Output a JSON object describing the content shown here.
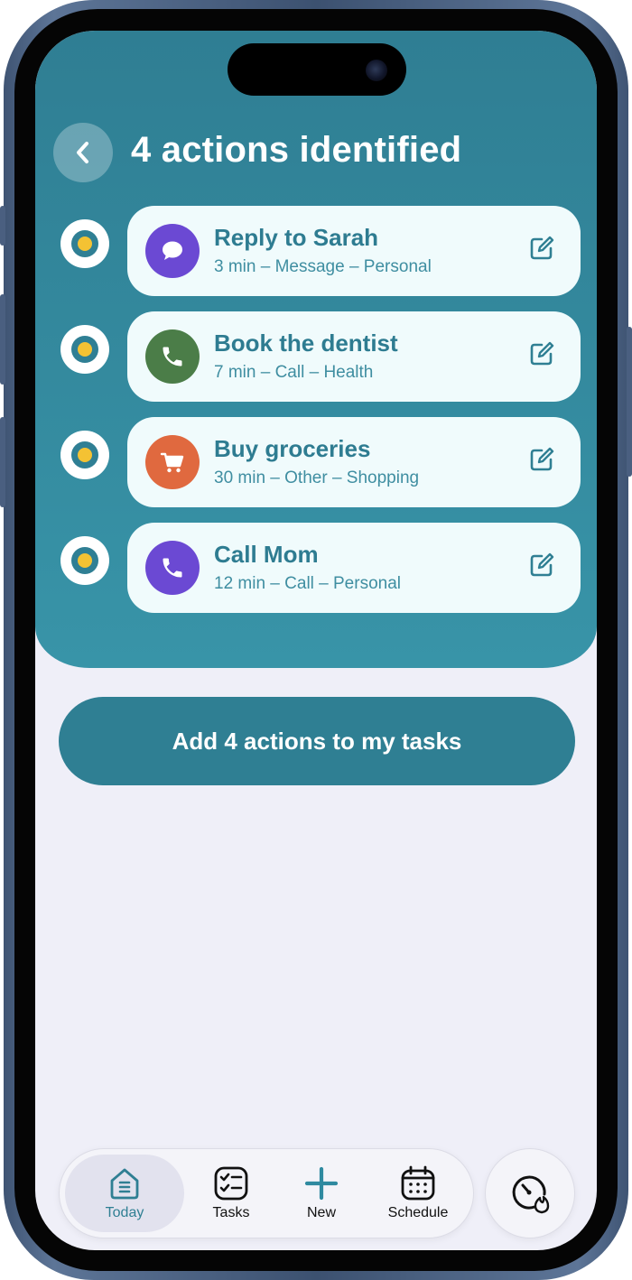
{
  "header": {
    "title": "4 actions identified",
    "back_icon": "chevron-left-icon"
  },
  "actions": [
    {
      "title": "Reply to Sarah",
      "meta": "3 min – Message – Personal",
      "icon": "message-bubble-icon",
      "icon_color": "#6b49d3"
    },
    {
      "title": "Book the dentist",
      "meta": "7 min – Call – Health",
      "icon": "phone-icon",
      "icon_color": "#4b7d48"
    },
    {
      "title": "Buy groceries",
      "meta": "30 min – Other – Shopping",
      "icon": "shopping-cart-icon",
      "icon_color": "#e0693f"
    },
    {
      "title": "Call Mom",
      "meta": "12 min – Call – Personal",
      "icon": "phone-icon",
      "icon_color": "#6b49d3"
    }
  ],
  "cta": {
    "label": "Add 4 actions to my tasks"
  },
  "tabbar": {
    "tabs": [
      {
        "label": "Today",
        "icon": "home-icon",
        "active": true
      },
      {
        "label": "Tasks",
        "icon": "checklist-icon",
        "active": false
      },
      {
        "label": "New",
        "icon": "plus-icon",
        "active": false
      },
      {
        "label": "Schedule",
        "icon": "calendar-icon",
        "active": false
      }
    ],
    "extra_button_icon": "gauge-flame-icon"
  },
  "colors": {
    "header_teal": "#2f7f93",
    "card_bg": "#f0fbfc",
    "accent_yellow": "#f4c233",
    "screen_bg": "#efeff8"
  }
}
